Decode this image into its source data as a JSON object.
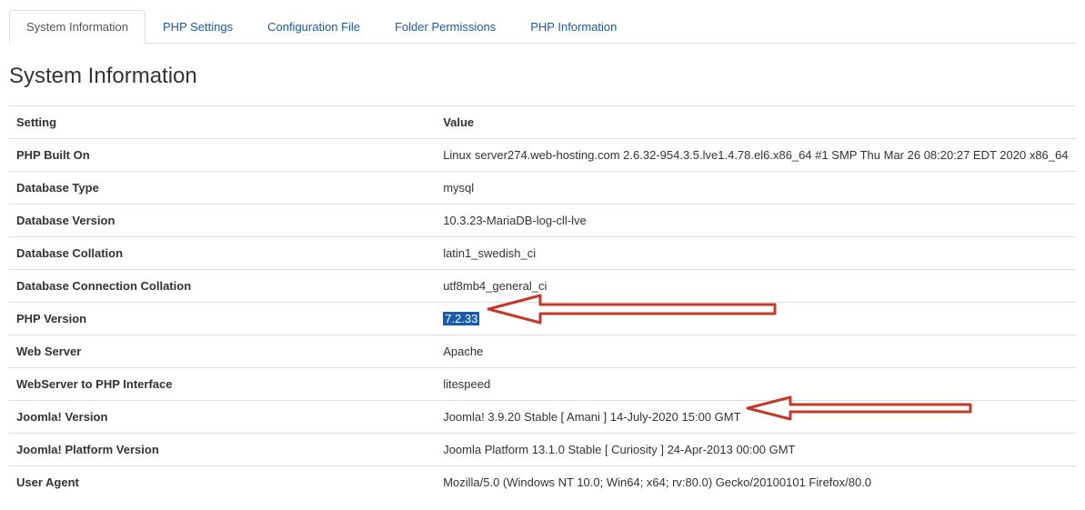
{
  "tabs": [
    {
      "label": "System Information"
    },
    {
      "label": "PHP Settings"
    },
    {
      "label": "Configuration File"
    },
    {
      "label": "Folder Permissions"
    },
    {
      "label": "PHP Information"
    }
  ],
  "pageTitle": "System Information",
  "table": {
    "headers": {
      "setting": "Setting",
      "value": "Value"
    },
    "rows": [
      {
        "setting": "PHP Built On",
        "value": "Linux server274.web-hosting.com 2.6.32-954.3.5.lve1.4.78.el6.x86_64 #1 SMP Thu Mar 26 08:20:27 EDT 2020 x86_64"
      },
      {
        "setting": "Database Type",
        "value": "mysql"
      },
      {
        "setting": "Database Version",
        "value": "10.3.23-MariaDB-log-cll-lve"
      },
      {
        "setting": "Database Collation",
        "value": "latin1_swedish_ci"
      },
      {
        "setting": "Database Connection Collation",
        "value": "utf8mb4_general_ci"
      },
      {
        "setting": "PHP Version",
        "value": "7.2.33",
        "highlighted": true,
        "arrow": 1
      },
      {
        "setting": "Web Server",
        "value": "Apache"
      },
      {
        "setting": "WebServer to PHP Interface",
        "value": "litespeed"
      },
      {
        "setting": "Joomla! Version",
        "value": "Joomla! 3.9.20 Stable [ Amani ] 14-July-2020 15:00 GMT",
        "arrow": 2
      },
      {
        "setting": "Joomla! Platform Version",
        "value": "Joomla Platform 13.1.0 Stable [ Curiosity ] 24-Apr-2013 00:00 GMT"
      },
      {
        "setting": "User Agent",
        "value": "Mozilla/5.0 (Windows NT 10.0; Win64; x64; rv:80.0) Gecko/20100101 Firefox/80.0"
      }
    ]
  }
}
